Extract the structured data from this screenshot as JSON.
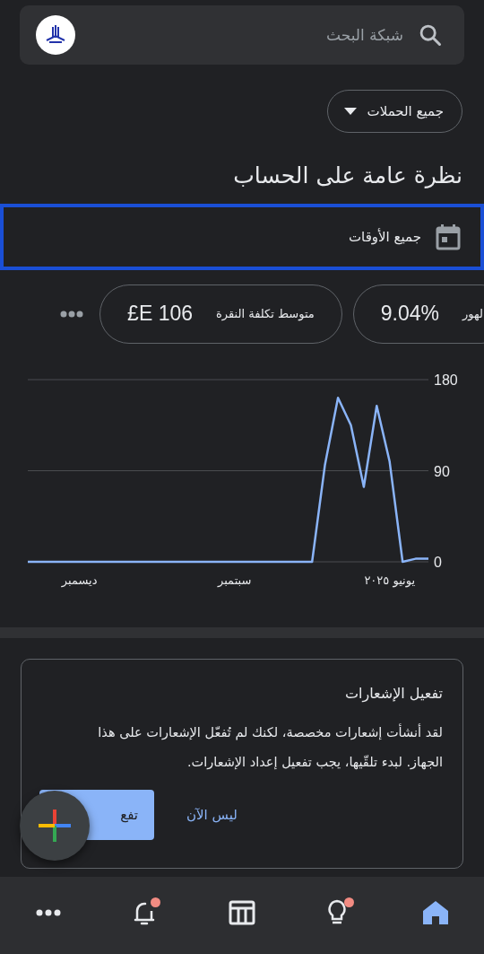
{
  "search": {
    "placeholder": "شبكة البحث"
  },
  "campaign_filter": {
    "label": "جميع الحملات"
  },
  "title": "نظرة عامة على الحساب",
  "date_range": {
    "label": "جميع الأوقات",
    "focused": true
  },
  "metrics": [
    {
      "label": "لهور",
      "value": "9.04%",
      "selected": false
    },
    {
      "label": "متوسط تكلفة النقرة",
      "value": "£E 106",
      "selected": false
    }
  ],
  "chart": {
    "chart_data": {
      "type": "line",
      "categories": [
        null,
        null,
        null,
        null,
        "ديسمبر",
        null,
        null,
        null,
        null,
        null,
        null,
        null,
        null,
        null,
        null,
        null,
        "سبتمبر",
        null,
        null,
        null,
        null,
        null,
        null,
        null,
        null,
        null,
        null,
        null,
        "يونيو ٢٠٢٥",
        null,
        null,
        null
      ],
      "series": [
        {
          "color": "#8ab4f8",
          "values": [
            0,
            0,
            0,
            0,
            0,
            0,
            0,
            0,
            0,
            0,
            0,
            0,
            0,
            0,
            0,
            0,
            0,
            0,
            0,
            0,
            0,
            0,
            0,
            96,
            162,
            135,
            74,
            154,
            99,
            0,
            3,
            3
          ]
        }
      ],
      "ylim": [
        0,
        180
      ],
      "yticks": [
        0,
        90,
        180
      ]
    }
  },
  "notice": {
    "title": "تفعيل الإشعارات",
    "body": "لقد أنشأت إشعارات مخصصة، لكنك لم تُفعّل الإشعارات على هذا الجهاز. لبدء تلقّيها، يجب تفعيل إعداد الإشعارات.",
    "buttons": [
      {
        "label": "ليس الآن",
        "kind": "text"
      },
      {
        "label": "تفع",
        "kind": "primary"
      }
    ]
  },
  "nav": [
    {
      "kind": "home",
      "selected": true,
      "badge": false
    },
    {
      "kind": "insights",
      "selected": false,
      "badge": true
    },
    {
      "kind": "table",
      "selected": false,
      "badge": false
    },
    {
      "kind": "alerts",
      "selected": false,
      "badge": true
    },
    {
      "kind": "more",
      "selected": false,
      "badge": false
    }
  ]
}
